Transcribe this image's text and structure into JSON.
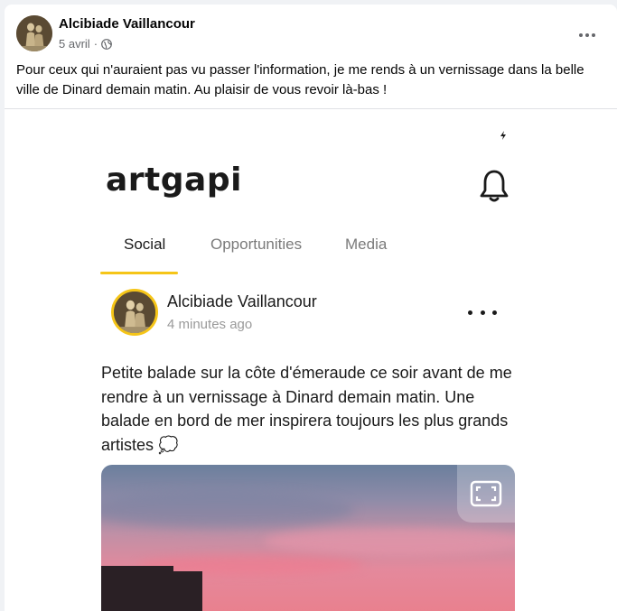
{
  "post": {
    "author": "Alcibiade Vaillancour",
    "date": "5 avril",
    "separator": "·",
    "text": "Pour ceux qui n'auraient pas vu passer l'information, je me rends à un vernissage dans la belle ville de Dinard demain matin. Au plaisir de vous revoir là-bas !"
  },
  "app": {
    "logo": "artgapi",
    "tabs": [
      {
        "label": "Social",
        "active": true
      },
      {
        "label": "Opportunities",
        "active": false
      },
      {
        "label": "Media",
        "active": false
      }
    ],
    "post": {
      "author": "Alcibiade Vaillancour",
      "time": "4 minutes ago",
      "text": "Petite balade sur la côte d'émeraude ce soir avant de me rendre à un vernissage à Dinard demain matin. Une balade en bord de mer inspirera toujours les plus grands artistes 💭"
    },
    "accent_color": "#f5c518"
  },
  "icons": {
    "privacy": "globe-icon",
    "more": "more-horizontal-icon",
    "notifications": "bell-icon",
    "expand": "expand-icon",
    "status": "flash-icon"
  }
}
